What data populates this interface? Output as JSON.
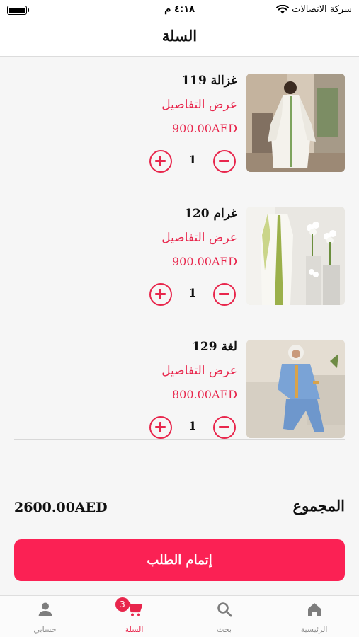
{
  "status_bar": {
    "carrier": "شركة الاتصالات",
    "time": "٤:١٨ م"
  },
  "header": {
    "title": "السلة"
  },
  "cart": {
    "items": [
      {
        "name": "غزالة 119",
        "details_label": "عرض التفاصيل",
        "price": "900.00AED",
        "quantity": "1"
      },
      {
        "name": "غرام 120",
        "details_label": "عرض التفاصيل",
        "price": "900.00AED",
        "quantity": "1"
      },
      {
        "name": "لغة 129",
        "details_label": "عرض التفاصيل",
        "price": "800.00AED",
        "quantity": "1"
      }
    ],
    "total_label": "المجموع",
    "total_value": "2600.00AED",
    "checkout_label": "إتمام الطلب"
  },
  "tab_bar": {
    "tabs": [
      {
        "label": "الرئيسية",
        "icon": "home-icon"
      },
      {
        "label": "بحث",
        "icon": "search-icon"
      },
      {
        "label": "السلة",
        "icon": "cart-icon",
        "badge": "3"
      },
      {
        "label": "حسابي",
        "icon": "user-icon"
      }
    ]
  },
  "colors": {
    "accent": "#e8264c",
    "checkout": "#fb2154",
    "inactive": "#8a8a8a"
  }
}
